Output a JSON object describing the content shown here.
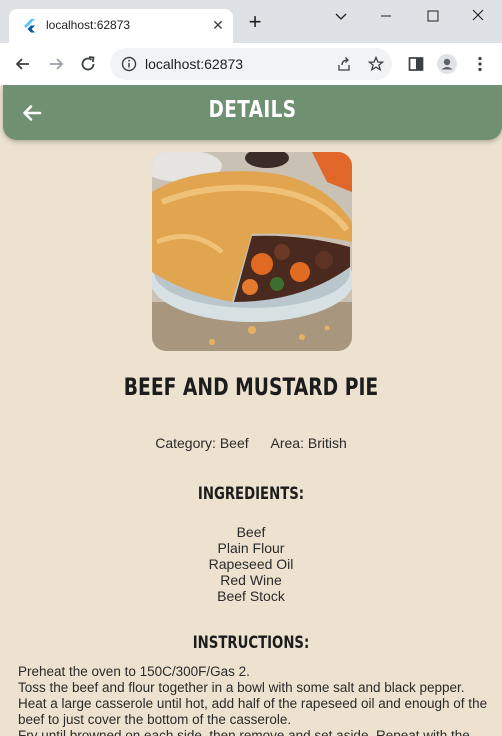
{
  "browser": {
    "tab_title": "localhost:62873",
    "url": "localhost:62873"
  },
  "app": {
    "title": "DETAILS",
    "meal_name": "BEEF AND MUSTARD PIE",
    "category": "Category: Beef",
    "area": "Area: British",
    "ingredients_heading": "INGREDIENTS:",
    "ingredients": [
      "Beef",
      "Plain Flour",
      "Rapeseed Oil",
      "Red Wine",
      "Beef Stock"
    ],
    "instructions_heading": "INSTRUCTIONS:",
    "instructions": [
      "Preheat the oven to 150C/300F/Gas 2.",
      "Toss the beef and flour together in a bowl with some salt and black pepper.",
      "Heat a large casserole until hot, add half of the rapeseed oil and enough of the beef to just cover the bottom of the casserole.",
      "Fry until browned on each side, then remove and set aside. Repeat with the"
    ],
    "colors": {
      "appbar": "#6f9071",
      "background": "#ece2cf"
    }
  },
  "icons": [
    "flutter-favicon-icon",
    "close-icon",
    "plus-icon",
    "chevron-down-icon",
    "minimize-icon",
    "maximize-icon",
    "window-close-icon",
    "back-icon",
    "forward-icon",
    "reload-icon",
    "info-icon",
    "share-icon",
    "star-icon",
    "sidebar-icon",
    "profile-icon",
    "more-vert-icon",
    "arrow-back-icon"
  ]
}
